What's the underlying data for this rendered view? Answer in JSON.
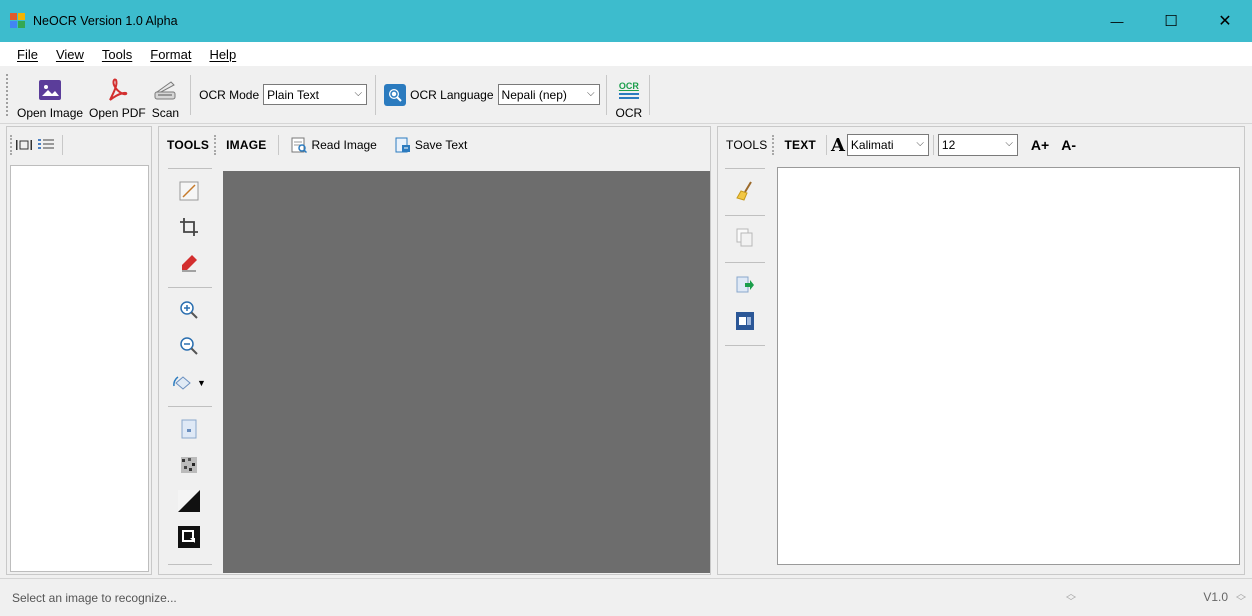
{
  "window": {
    "title": "NeOCR Version 1.0 Alpha",
    "controls": {
      "minimize": "—",
      "maximize": "☐",
      "close": "✕"
    }
  },
  "menu": [
    "File",
    "View",
    "Tools",
    "Format",
    "Help"
  ],
  "toolbar": {
    "open_image": "Open Image",
    "open_pdf": "Open PDF",
    "scan": "Scan",
    "ocr_mode_label": "OCR Mode",
    "ocr_mode_value": "Plain Text",
    "ocr_language_label": "OCR Language",
    "ocr_language_value": "Nepali (nep)",
    "ocr_button_top": "OCR",
    "ocr_button_label": "OCR"
  },
  "image_panel": {
    "tools_label": "TOOLS",
    "image_label": "IMAGE",
    "read_image": "Read Image",
    "save_text": "Save Text"
  },
  "text_panel": {
    "tools_label": "TOOLS",
    "text_label": "TEXT",
    "font_glyph": "A",
    "font_name": "Kalimati",
    "font_size": "12",
    "increase_font": "A+",
    "decrease_font": "A-"
  },
  "status": {
    "message": "Select an image to recognize...",
    "version": "V1.0"
  },
  "colors": {
    "titlebar": "#3dbccd",
    "image_canvas": "#6d6d6d",
    "open_image_icon": "#5b3d9a",
    "pdf_red": "#d32f2f",
    "ocr_green": "#1b9e4b"
  }
}
